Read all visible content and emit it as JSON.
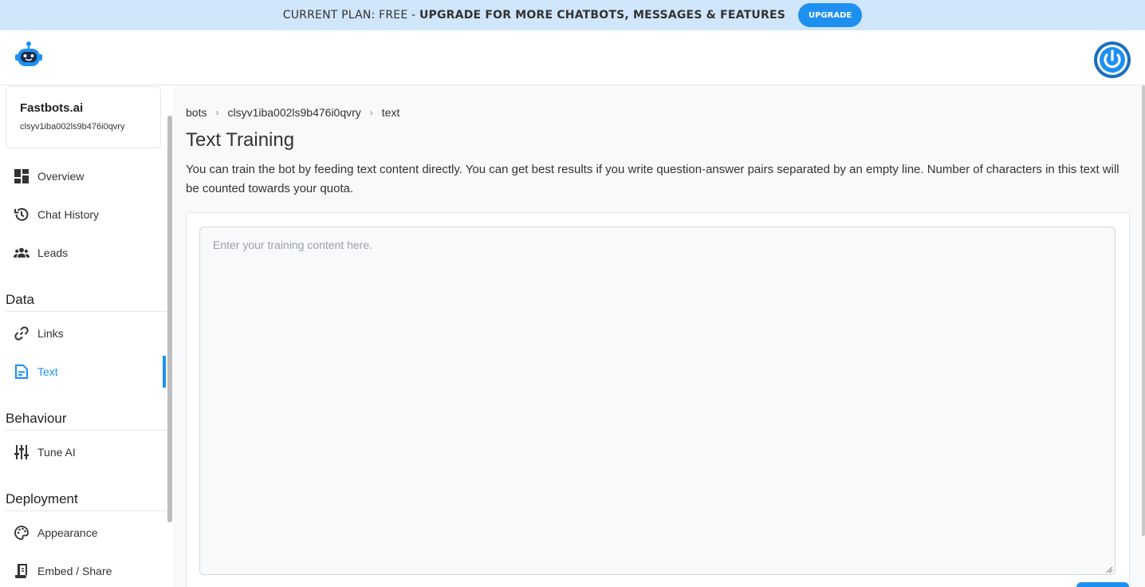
{
  "banner": {
    "plan_label": "CURRENT PLAN: FREE - ",
    "upgrade_message": "UPGRADE FOR MORE CHATBOTS, MESSAGES & FEATURES",
    "upgrade_button": "UPGRADE"
  },
  "header": {
    "logo_icon": "robot-logo-icon",
    "power_icon": "power-icon"
  },
  "sidebar": {
    "bot_name": "Fastbots.ai",
    "bot_id": "clsyv1iba002ls9b476i0qvry",
    "items": [
      {
        "label": "Overview",
        "icon": "grid-icon"
      },
      {
        "label": "Chat History",
        "icon": "history-icon"
      },
      {
        "label": "Leads",
        "icon": "users-icon"
      }
    ],
    "sections": [
      {
        "title": "Data",
        "items": [
          {
            "label": "Links",
            "icon": "link-icon"
          },
          {
            "label": "Text",
            "icon": "document-icon",
            "active": true
          }
        ]
      },
      {
        "title": "Behaviour",
        "items": [
          {
            "label": "Tune AI",
            "icon": "sliders-icon"
          }
        ]
      },
      {
        "title": "Deployment",
        "items": [
          {
            "label": "Appearance",
            "icon": "palette-icon"
          },
          {
            "label": "Embed / Share",
            "icon": "scroll-icon"
          }
        ]
      }
    ]
  },
  "main": {
    "breadcrumb": [
      "bots",
      "clsyv1iba002ls9b476i0qvry",
      "text"
    ],
    "title": "Text Training",
    "description": "You can train the bot by feeding text content directly. You can get best results if you write question-answer pairs separated by an empty line. Number of characters in this text will be counted towards your quota.",
    "textarea_placeholder": "Enter your training content here.",
    "textarea_value": ""
  },
  "colors": {
    "accent": "#1e90f0",
    "banner_bg": "#cfe6fb",
    "main_bg": "#f8f9fb"
  }
}
